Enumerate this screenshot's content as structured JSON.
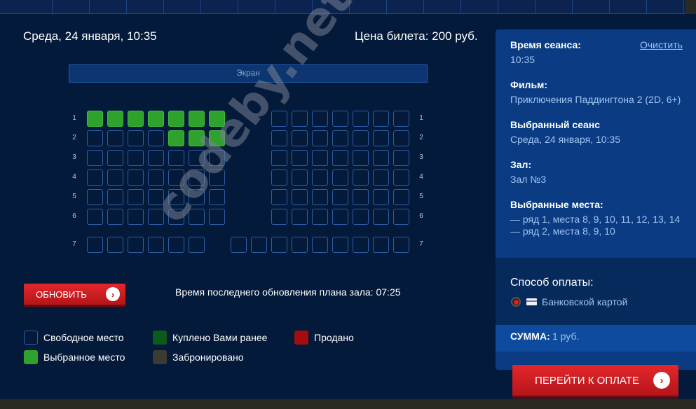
{
  "session": {
    "datetime": "Среда, 24 января, 10:35",
    "price": "Цена билета: 200 руб."
  },
  "hall": {
    "screen_label": "Экран",
    "row_labels": [
      "1",
      "2",
      "3",
      "4",
      "5",
      "6",
      "7"
    ],
    "selected_seats": {
      "row_1": "места 8, 9, 10, 11, 12, 13, 14",
      "row_2": "места 8, 9, 10"
    }
  },
  "controls": {
    "refresh_label": "ОБНОВИТЬ",
    "refresh_icon": "chevron-right-icon",
    "last_update": "Время последнего обновления плана зала: 07:25"
  },
  "legend": {
    "free": "Свободное место",
    "selected": "Выбранное место",
    "bought": "Куплено Вами ранее",
    "reserved": "Забронировано",
    "sold": "Продано"
  },
  "colors": {
    "free_border": "#2c5fa8",
    "selected": "#2fa22e",
    "bought": "#0d5a1c",
    "reserved": "#3b3b32",
    "sold": "#a40d0d",
    "accent_red": "#d11a1f",
    "panel_bg": "#0b3c83"
  },
  "panel": {
    "session_time_label": "Время сеанса:",
    "session_time_value": "10:35",
    "clear_label": "Очистить",
    "film_label": "Фильм:",
    "film_value": "Приключения Паддингтона 2 (2D, 6+)",
    "chosen_session_label": "Выбранный сеанс",
    "chosen_session_value": "Среда, 24 января, 10:35",
    "hall_label": "Зал:",
    "hall_value": "Зал №3",
    "seats_label": "Выбранные места:",
    "seats_line1": "— ряд 1, места 8, 9, 10, 11, 12, 13, 14",
    "seats_line2": "— ряд 2, места 8, 9, 10",
    "payment_label": "Способ оплаты:",
    "payment_option": "Банковской картой",
    "sum_label": "СУММА:",
    "sum_value": "1 руб.",
    "pay_button": "ПЕРЕЙТИ К ОПЛАТЕ"
  },
  "watermark": "codeby.net"
}
